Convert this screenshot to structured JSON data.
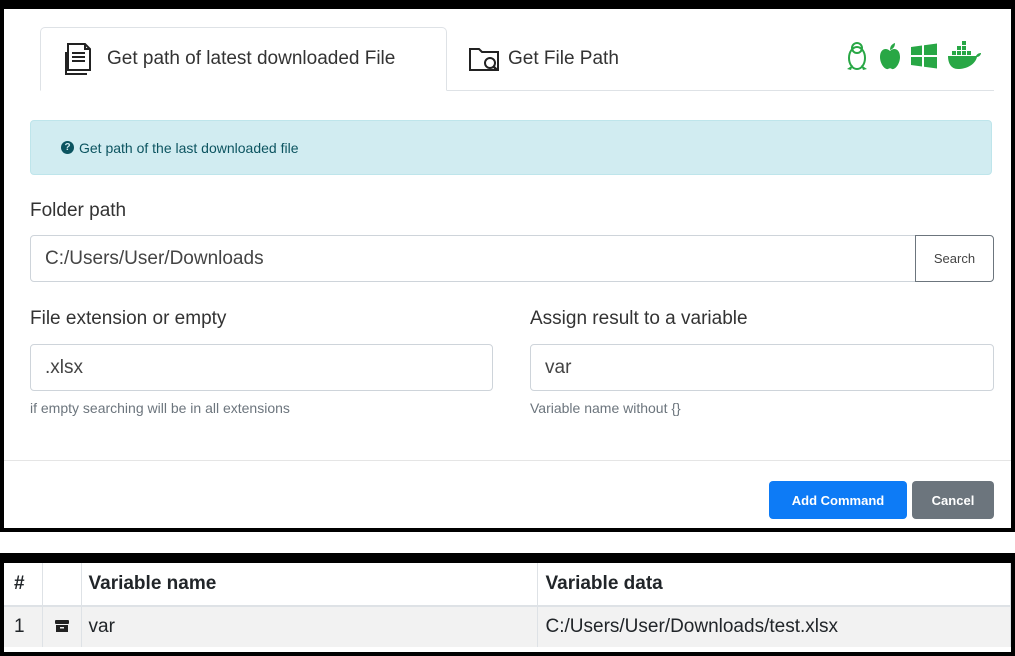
{
  "tabs": [
    {
      "label": "Get path of latest downloaded File",
      "icon": "file-lines-icon",
      "active": true
    },
    {
      "label": "Get File Path",
      "icon": "folder-search-icon",
      "active": false
    }
  ],
  "os_icons": [
    "linux-icon",
    "apple-icon",
    "windows-icon",
    "docker-icon"
  ],
  "colors": {
    "accent_green": "#28a745",
    "primary": "#0d7bf6",
    "secondary": "#6c757d",
    "info_bg": "#d1ecf1",
    "info_text": "#0c5460"
  },
  "alert": {
    "icon": "question-circle-icon",
    "text": "Get path of the last downloaded file"
  },
  "folder": {
    "label": "Folder path",
    "value": "C:/Users/User/Downloads",
    "button": "Search"
  },
  "extension": {
    "label": "File extension or empty",
    "value": ".xlsx",
    "help": "if empty searching will be in all extensions"
  },
  "variable": {
    "label": "Assign result to a variable",
    "value": "var",
    "help": "Variable name without {}"
  },
  "actions": {
    "add": "Add Command",
    "cancel": "Cancel"
  },
  "var_table": {
    "headers": [
      "#",
      "",
      "Variable name",
      "Variable data"
    ],
    "rows": [
      {
        "index": "1",
        "icon": "archive-icon",
        "name": "var",
        "data": "C:/Users/User/Downloads/test.xlsx"
      }
    ]
  }
}
